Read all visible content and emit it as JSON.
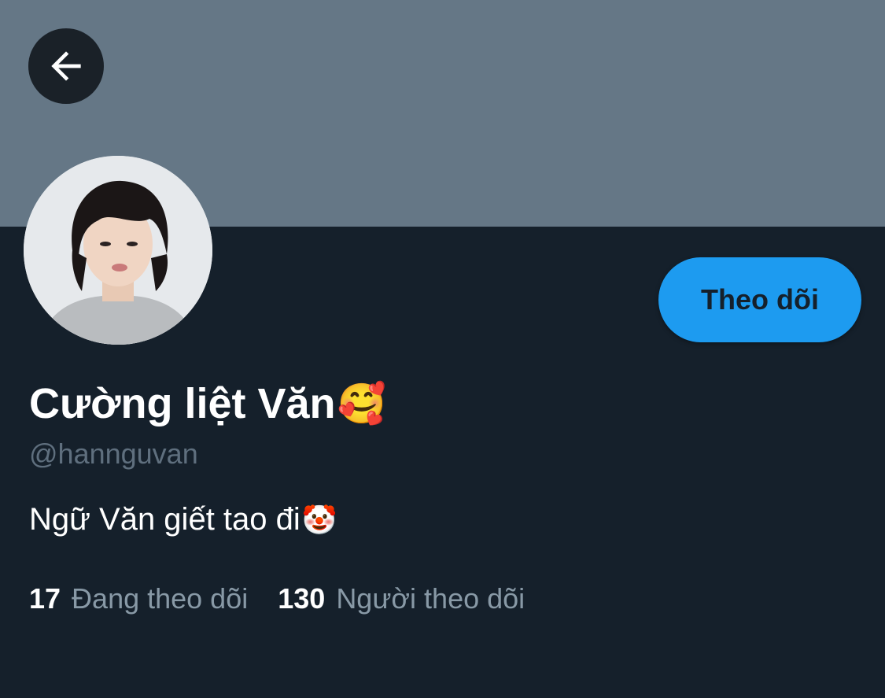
{
  "header": {
    "back_icon": "arrow-left-icon",
    "banner_color": "#657786"
  },
  "profile": {
    "avatar": "profile-photo",
    "display_name": "Cường liệt Văn",
    "display_name_emoji": "🥰",
    "username": "@hannguvan",
    "bio": "Ngữ Văn giết tao đi",
    "bio_emoji": "🤡"
  },
  "actions": {
    "follow_label": "Theo dõi",
    "accent_color": "#1d9bf0"
  },
  "stats": {
    "following_count": "17",
    "following_label": "Đang theo dõi",
    "followers_count": "130",
    "followers_label": "Người theo dõi"
  },
  "theme": {
    "background": "#15202b",
    "text_primary": "#ffffff",
    "text_secondary": "#8899a6"
  }
}
